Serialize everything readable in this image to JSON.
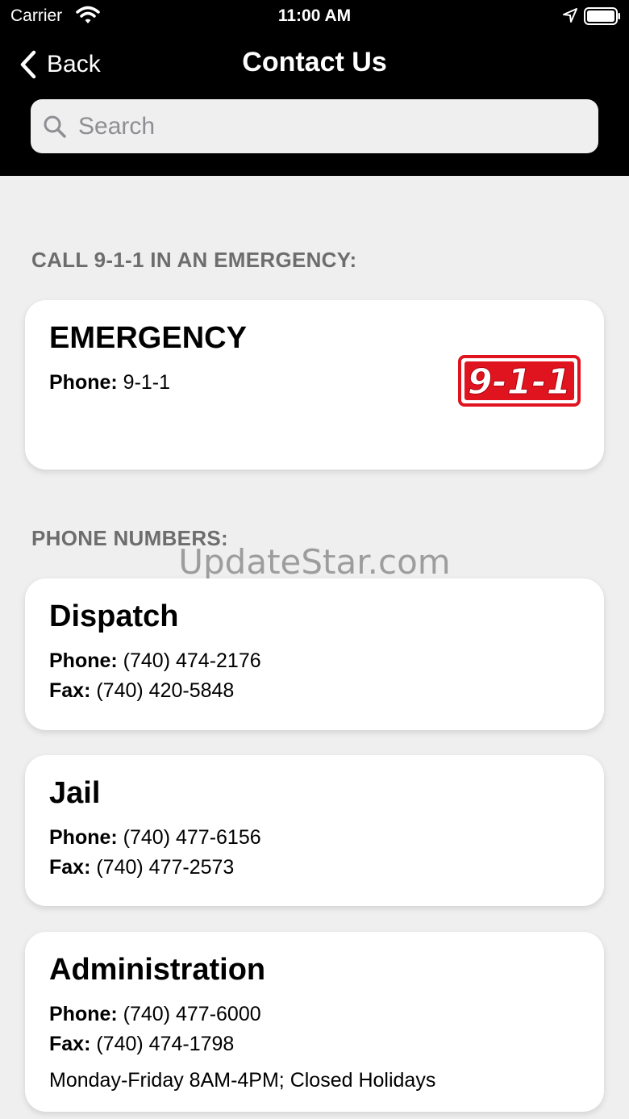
{
  "status_bar": {
    "carrier": "Carrier",
    "time": "11:00 AM"
  },
  "nav": {
    "back_label": "Back",
    "title": "Contact Us"
  },
  "search": {
    "placeholder": "Search"
  },
  "sections": {
    "emergency_header": "CALL 9-1-1 IN AN EMERGENCY:",
    "phones_header": "PHONE NUMBERS:"
  },
  "cards": {
    "emergency": {
      "title": "EMERGENCY",
      "phone_label": "Phone:",
      "phone": "9-1-1",
      "logo_text": "9-1-1"
    },
    "dispatch": {
      "title": "Dispatch",
      "phone_label": "Phone:",
      "phone": "(740) 474-2176",
      "fax_label": "Fax:",
      "fax": "(740) 420-5848"
    },
    "jail": {
      "title": "Jail",
      "phone_label": "Phone:",
      "phone": "(740) 477-6156",
      "fax_label": "Fax:",
      "fax": "(740) 477-2573"
    },
    "administration": {
      "title": "Administration",
      "phone_label": "Phone:",
      "phone": "(740) 477-6000",
      "fax_label": "Fax:",
      "fax": "(740) 474-1798",
      "hours": "Monday-Friday 8AM-4PM; Closed Holidays"
    }
  },
  "watermark": "UpdateStar.com",
  "colors": {
    "header_bg": "#000000",
    "page_bg": "#efefef",
    "section_text": "#6d6d6d",
    "logo_red": "#e0141e"
  }
}
